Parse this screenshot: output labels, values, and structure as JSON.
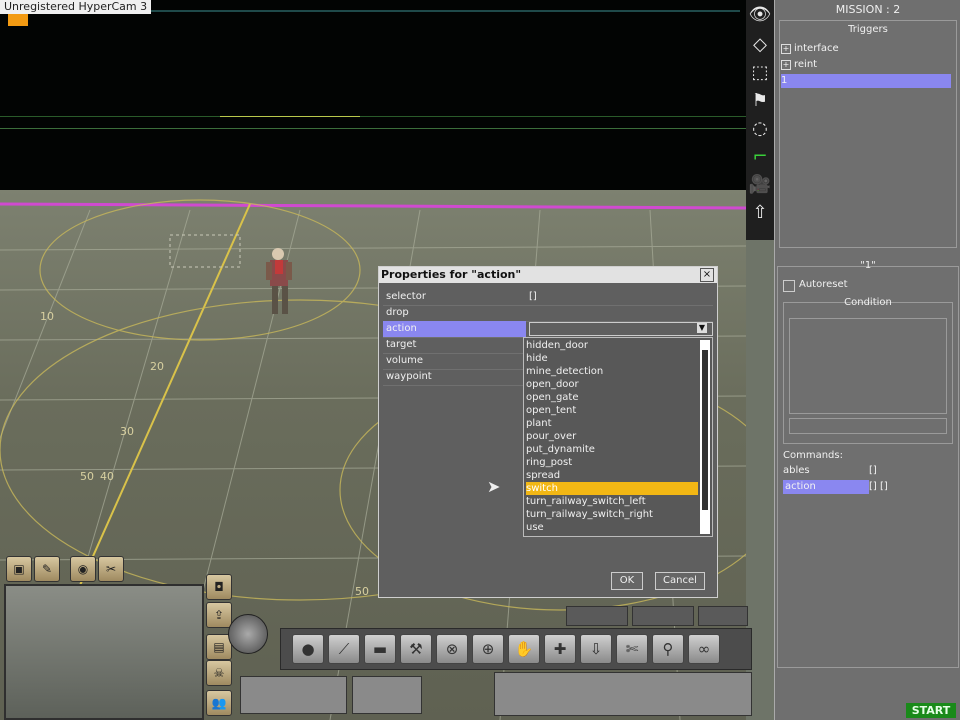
{
  "recorder": {
    "label": "Unregistered HyperCam 3"
  },
  "right_panel": {
    "mission_title": "MISSION : 2",
    "triggers_title": "Triggers",
    "triggers": [
      {
        "label": "interface",
        "expand": "+"
      },
      {
        "label": "reint",
        "expand": "+"
      },
      {
        "label": "1",
        "expand": ""
      }
    ],
    "selected_trigger_title": "\"1\"",
    "autoreset_label": "Autoreset",
    "condition_title": "Condition",
    "commands_label": "Commands:",
    "commands": [
      {
        "name": "ables",
        "args": "[]"
      },
      {
        "name": "action",
        "args": "[] []"
      }
    ],
    "start_label": "START"
  },
  "tool_icons": [
    "eye-icon",
    "cube-icon",
    "select-area-icon",
    "flag-icon",
    "circle-icon",
    "step-icon",
    "camera-icon",
    "arrow-up-icon"
  ],
  "dialog": {
    "title": "Properties for \"action\"",
    "close": "×",
    "properties": [
      {
        "name": "selector",
        "value": "[]"
      },
      {
        "name": "drop",
        "value": ""
      },
      {
        "name": "action",
        "value": ""
      },
      {
        "name": "target",
        "value": ""
      },
      {
        "name": "volume",
        "value": ""
      },
      {
        "name": "waypoint",
        "value": ""
      }
    ],
    "dropdown_items": [
      "hidden_door",
      "hide",
      "mine_detection",
      "open_door",
      "open_gate",
      "open_tent",
      "plant",
      "pour_over",
      "put_dynamite",
      "ring_post",
      "spread",
      "switch",
      "turn_railway_switch_left",
      "turn_railway_switch_right",
      "use"
    ],
    "highlighted_item": "switch",
    "ok_label": "OK",
    "cancel_label": "Cancel"
  },
  "ground_labels": [
    "10",
    "20",
    "30",
    "40",
    "50",
    "50"
  ],
  "colors": {
    "selection": "#8a87f0",
    "highlight": "#f2b714",
    "start": "#1a8a1a"
  }
}
